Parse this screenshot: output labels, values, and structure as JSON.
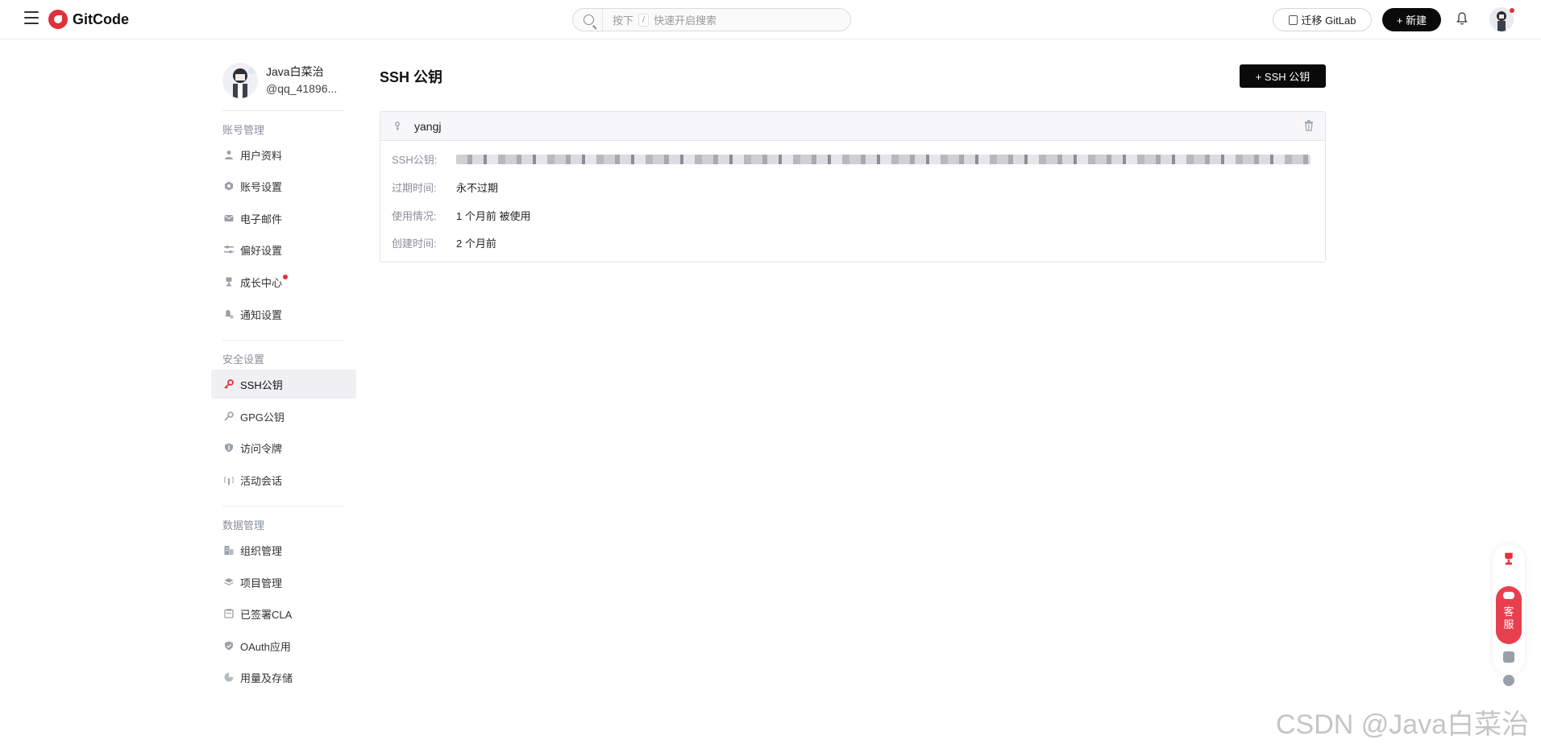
{
  "header": {
    "brand": "GitCode",
    "search_key_prefix": "按下",
    "search_key": "/",
    "search_hint": "快速开启搜索",
    "migrate_label": "迁移 GitLab",
    "new_label": "+ 新建"
  },
  "profile": {
    "name": "Java白菜治",
    "handle": "@qq_41896..."
  },
  "sidebar": {
    "sections": [
      {
        "title": "账号管理",
        "items": [
          {
            "label": "用户资料",
            "icon": "user-icon"
          },
          {
            "label": "账号设置",
            "icon": "gear-icon"
          },
          {
            "label": "电子邮件",
            "icon": "mail-icon"
          },
          {
            "label": "偏好设置",
            "icon": "sliders-icon"
          },
          {
            "label": "成长中心",
            "icon": "trophy-icon"
          },
          {
            "label": "通知设置",
            "icon": "bell-gear-icon"
          }
        ]
      },
      {
        "title": "安全设置",
        "items": [
          {
            "label": "SSH公钥",
            "icon": "key-icon"
          },
          {
            "label": "GPG公钥",
            "icon": "key-icon"
          },
          {
            "label": "访问令牌",
            "icon": "shield-icon"
          },
          {
            "label": "活动会话",
            "icon": "signal-icon"
          }
        ]
      },
      {
        "title": "数据管理",
        "items": [
          {
            "label": "组织管理",
            "icon": "building-icon"
          },
          {
            "label": "项目管理",
            "icon": "layers-icon"
          },
          {
            "label": "已签署CLA",
            "icon": "document-icon"
          },
          {
            "label": "OAuth应用",
            "icon": "shield-check-icon"
          },
          {
            "label": "用量及存储",
            "icon": "pie-icon"
          }
        ]
      }
    ]
  },
  "main": {
    "title": "SSH 公钥",
    "add_button": "+ SSH 公钥",
    "key": {
      "name": "yangj",
      "rows": [
        {
          "label": "SSH公钥:",
          "value": ""
        },
        {
          "label": "过期时间:",
          "value": "永不过期"
        },
        {
          "label": "使用情况:",
          "value": "1 个月前 被使用"
        },
        {
          "label": "创建时间:",
          "value": "2 个月前"
        }
      ]
    }
  },
  "floating": {
    "service_label_1": "客",
    "service_label_2": "服"
  },
  "watermark": "CSDN @Java白菜治",
  "colors": {
    "accent": "#e0303a",
    "primary_button": "#0a0a0a",
    "active_item_bg": "#f0f0f4"
  }
}
